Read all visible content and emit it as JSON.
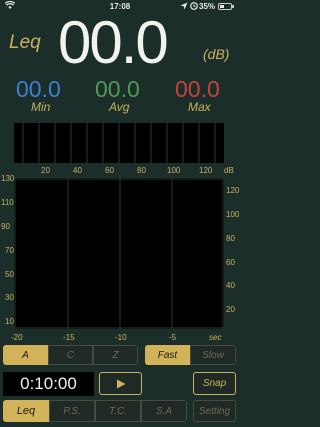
{
  "status": {
    "time": "17:08",
    "battery": "35%"
  },
  "meter": {
    "mode_label": "Leq",
    "value": "00.0",
    "unit": "(dB)"
  },
  "stats": {
    "min": {
      "value": "00.0",
      "label": "Min",
      "color": "#3d7fd1"
    },
    "avg": {
      "value": "00.0",
      "label": "Avg",
      "color": "#4f9a55"
    },
    "max": {
      "value": "00.0",
      "label": "Max",
      "color": "#c5433c"
    }
  },
  "mini_graph": {
    "ticks": [
      "20",
      "40",
      "60",
      "80",
      "100",
      "120"
    ],
    "unit": "dB"
  },
  "plot": {
    "y_ticks": [
      "130",
      "120",
      "110",
      "100",
      "90",
      "80",
      "70",
      "60",
      "50",
      "40",
      "30",
      "20",
      "10"
    ],
    "x_ticks": [
      "-20",
      "-15",
      "-10",
      "-5"
    ],
    "x_unit": "sec"
  },
  "weighting": {
    "options": [
      "A",
      "C",
      "Z"
    ],
    "selected": "A"
  },
  "response": {
    "options": [
      "Fast",
      "Slow"
    ],
    "selected": "Fast"
  },
  "timer": {
    "value": "0:10:00"
  },
  "controls": {
    "snap": "Snap",
    "setting": "Setting"
  },
  "tabs": {
    "items": [
      "Leq",
      "P.S.",
      "T.C.",
      "S.A"
    ],
    "selected": "Leq"
  }
}
